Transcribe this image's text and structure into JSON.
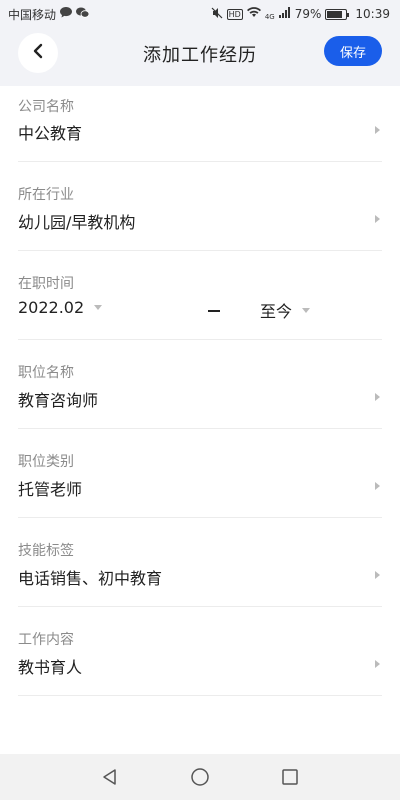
{
  "status_bar": {
    "carrier": "中国移动",
    "network": "HD",
    "signal": "4G",
    "battery_percent": "79%",
    "battery_level": 0.79,
    "time": "10:39"
  },
  "nav": {
    "title": "添加工作经历",
    "save_label": "保存"
  },
  "fields": {
    "company": {
      "label": "公司名称",
      "value": "中公教育"
    },
    "industry": {
      "label": "所在行业",
      "value": "幼儿园/早教机构"
    },
    "employment": {
      "label": "在职时间",
      "start": "2022.02",
      "end": "至今"
    },
    "position_name": {
      "label": "职位名称",
      "value": "教育咨询师"
    },
    "position_type": {
      "label": "职位类别",
      "value": "托管老师"
    },
    "skills": {
      "label": "技能标签",
      "value": "电话销售、初中教育"
    },
    "work_content": {
      "label": "工作内容",
      "value": "教书育人"
    }
  },
  "colors": {
    "accent": "#1a5eea",
    "header_bg": "#f2f3f7",
    "label": "#8b8b8b"
  }
}
